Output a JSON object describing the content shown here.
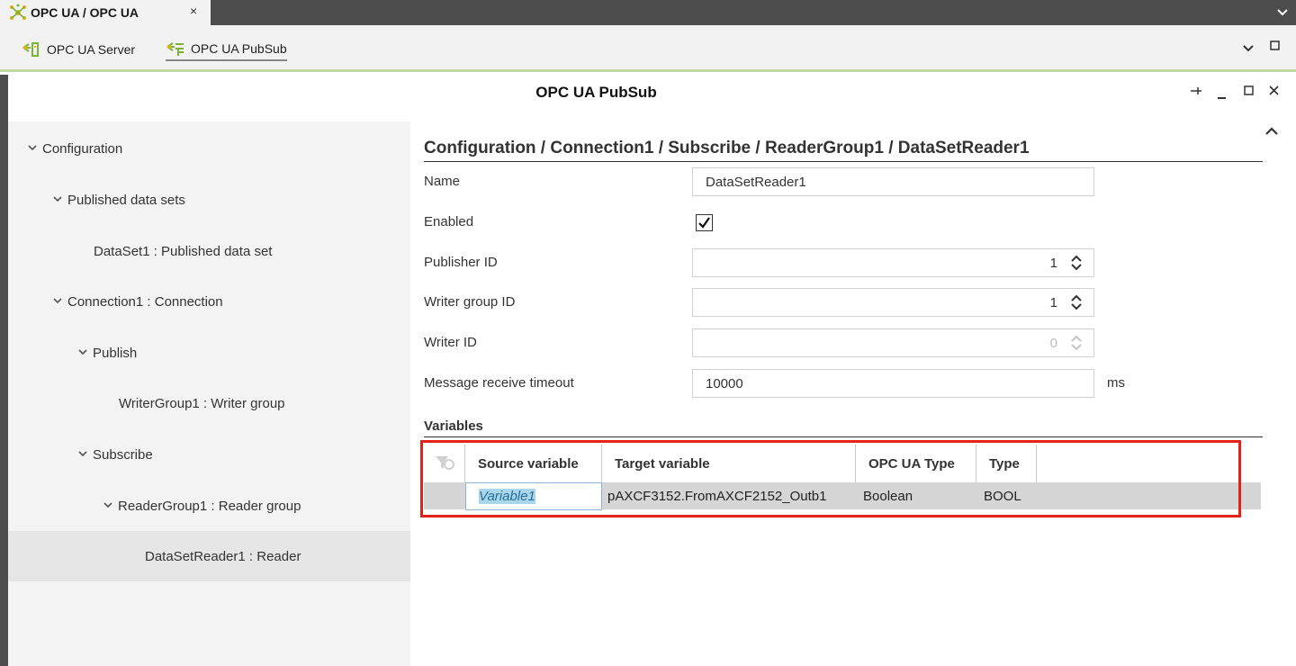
{
  "tabstrip": {
    "tab_label": "OPC UA / OPC UA",
    "close_glyph": "×",
    "dropdown_glyph": "⌄"
  },
  "editor_tabs": [
    {
      "label": "OPC UA Server",
      "icon": "server-icon"
    },
    {
      "label": "OPC UA PubSub",
      "icon": "pubsub-icon",
      "active": true
    }
  ],
  "panel": {
    "title": "OPC UA PubSub"
  },
  "tree": [
    {
      "label": "Configuration",
      "expanded": true,
      "level": 0
    },
    {
      "label": "Published data sets",
      "expanded": true,
      "level": 1
    },
    {
      "label": "DataSet1 : Published data set",
      "level": 2
    },
    {
      "label": "Connection1 : Connection",
      "expanded": true,
      "level": 1
    },
    {
      "label": "Publish",
      "expanded": true,
      "level": 2
    },
    {
      "label": "WriterGroup1 : Writer group",
      "level": 3
    },
    {
      "label": "Subscribe",
      "expanded": true,
      "level": 2
    },
    {
      "label": "ReaderGroup1 : Reader group",
      "expanded": true,
      "level": 3
    },
    {
      "label": "DataSetReader1 : Reader",
      "level": 4,
      "selected": true
    }
  ],
  "form": {
    "breadcrumb": "Configuration / Connection1 / Subscribe / ReaderGroup1 / DataSetReader1",
    "name_label": "Name",
    "name_value": "DataSetReader1",
    "enabled_label": "Enabled",
    "enabled_checked": true,
    "publisher_id_label": "Publisher ID",
    "publisher_id_value": "1",
    "writer_group_id_label": "Writer group ID",
    "writer_group_id_value": "1",
    "writer_id_label": "Writer ID",
    "writer_id_value": "0",
    "timeout_label": "Message receive timeout",
    "timeout_value": "10000",
    "timeout_unit": "ms"
  },
  "variables": {
    "title": "Variables",
    "columns": [
      "Source variable",
      "Target variable",
      "OPC UA Type",
      "Type"
    ],
    "rows": [
      {
        "source": "Variable1",
        "target": "pAXCF3152.FromAXCF2152_Outb1",
        "opcua_type": "Boolean",
        "type": "BOOL"
      }
    ]
  },
  "colors": {
    "accent_green": "#c4d8a3",
    "highlight_red": "#e2231a",
    "dark_chrome": "#4d4d4d"
  }
}
